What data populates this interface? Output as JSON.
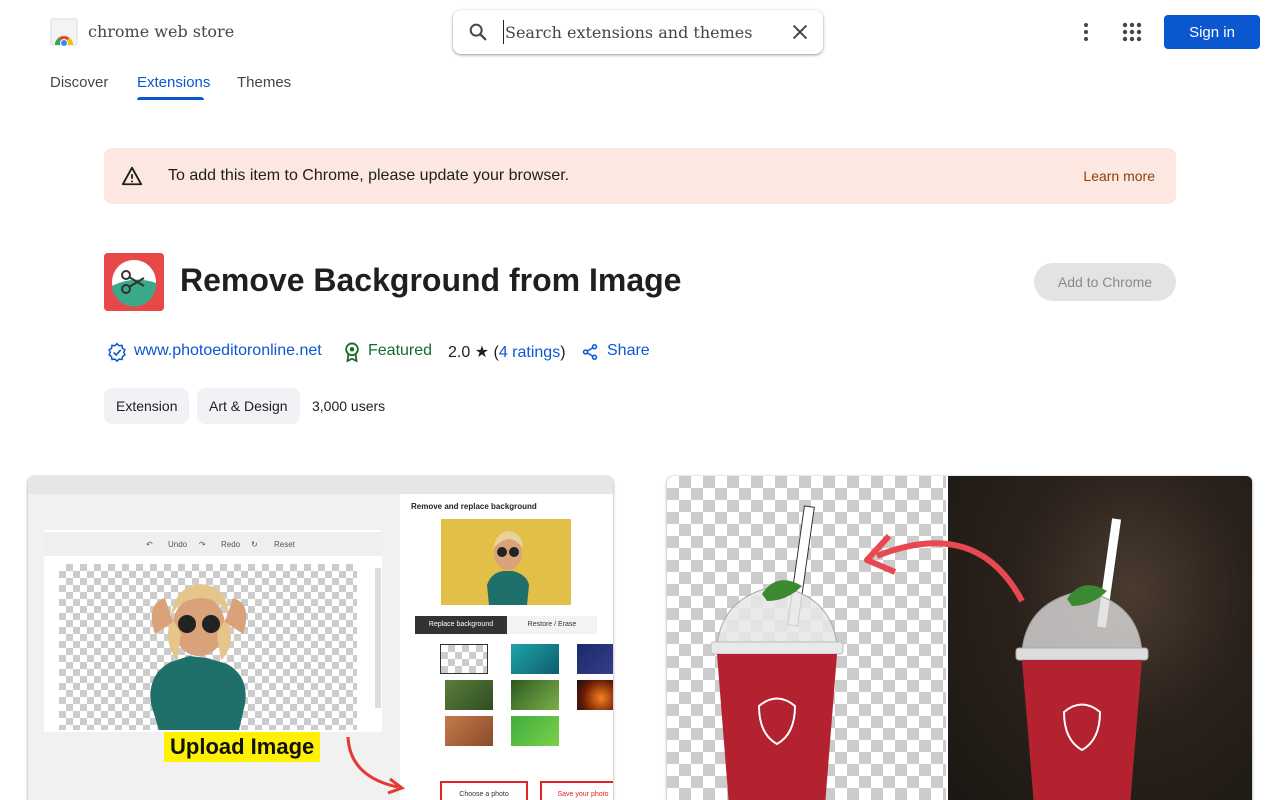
{
  "header": {
    "store_name": "chrome web store",
    "search_placeholder": "Search extensions and themes",
    "signin_label": "Sign in"
  },
  "tabs": [
    {
      "label": "Discover",
      "active": false
    },
    {
      "label": "Extensions",
      "active": true
    },
    {
      "label": "Themes",
      "active": false
    }
  ],
  "banner": {
    "message": "To add this item to Chrome, please update your browser.",
    "link": "Learn more"
  },
  "extension": {
    "title": "Remove Background from Image",
    "add_button": "Add to Chrome",
    "website": "www.photoeditoronline.net",
    "featured": "Featured",
    "rating_value": "2.0",
    "rating_open": " (",
    "ratings_link": "4 ratings",
    "rating_close": ")",
    "share": "Share",
    "chips": [
      "Extension",
      "Art & Design"
    ],
    "users": "3,000 users"
  },
  "screenshot1": {
    "undo": "Undo",
    "redo": "Redo",
    "reset": "Reset",
    "panel_title": "Remove and replace background",
    "tab_replace": "Replace background",
    "tab_restore": "Restore / Erase",
    "upload_label": "Upload Image",
    "choose_photo": "Choose a photo",
    "save_photo": "Save your photo"
  },
  "colors": {
    "accent": "#0b57d0",
    "banner_bg": "#fce8e0",
    "featured_green": "#146c2e",
    "icon_red": "#e84848",
    "icon_teal": "#3aa98a"
  }
}
